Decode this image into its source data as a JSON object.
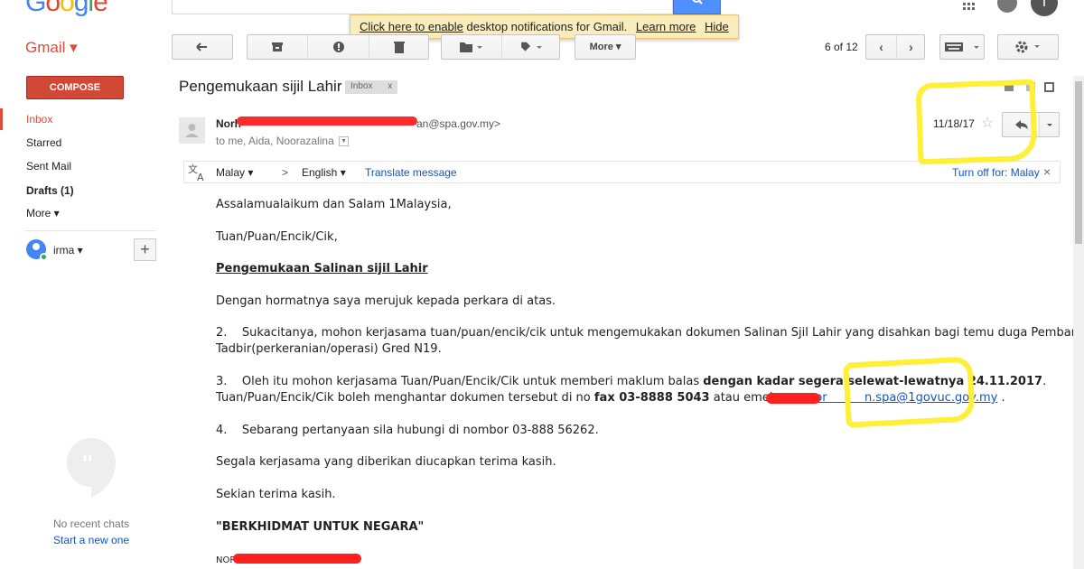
{
  "header": {
    "logo": [
      "G",
      "o",
      "o",
      "g",
      "l",
      "e"
    ],
    "notification": {
      "link1": "Click here to enable",
      "text": "desktop notifications for Gmail.",
      "learn_more": "Learn more",
      "hide": "Hide"
    },
    "avatar_letter": "I"
  },
  "sidebar": {
    "app_label": "Gmail ▾",
    "compose": "COMPOSE",
    "items": [
      {
        "label": "Inbox"
      },
      {
        "label": "Starred"
      },
      {
        "label": "Sent Mail"
      },
      {
        "label": "Drafts (1)"
      },
      {
        "label": "More ▾"
      }
    ],
    "user": "irma ▾",
    "no_chats": "No recent chats",
    "start_new": "Start a new one"
  },
  "toolbar": {
    "more": "More ▾",
    "pagination": "6 of 12"
  },
  "message": {
    "subject": "Pengemukaan sijil Lahir",
    "tag": "Inbox",
    "tag_close": "x",
    "sender_prefix": "Norh",
    "sender_suffix": "an@spa.gov.my>",
    "recipients": "to me, Aida, Noorazalina",
    "date": "11/18/17"
  },
  "translate": {
    "from": "Malay ▾",
    "arrow": ">",
    "to": "English ▾",
    "action": "Translate message",
    "turn_off": "Turn off for: Malay",
    "close": "×"
  },
  "body": {
    "greeting": "Assalamualaikum dan Salam 1Malaysia,",
    "salutation": "Tuan/Puan/Encik/Cik,",
    "heading": "Pengemukaan Salinan sijil Lahir",
    "p1": "Dengan hormatnya saya merujuk kepada perkara di atas.",
    "p2a": "2.    Sukacitanya, mohon kerjasama tuan/puan/encik/cik untuk mengemukakan dokumen Salinan Sjil Lahir yang disahkan bagi temu duga Pembantu",
    "p2b": "Tadbir(perkeranian/operasi) Gred N19.",
    "p3a": "3.    Oleh itu mohon kerjasama Tuan/Puan/Encik/Cik untuk memberi maklum balas ",
    "p3a_bold": "dengan kadar segera selewat-lewatnya 24.11.2017",
    "p3a_end": ".",
    "p3b": "Tuan/Puan/Encik/Cik boleh menghantar dokumen tersebut di no ",
    "p3b_bold": "fax 03-8888 5043",
    "p3b_mid": " atau emel saya ",
    "p3b_link": "nor          n.spa@1govuc.gov.my",
    "p3b_end": " .",
    "p4": "4.    Sebarang pertanyaan sila hubungi di nombor 03-888 56262.",
    "p5": "Segala kerjasama yang diberikan diucapkan terima kasih.",
    "p6": "Sekian terima kasih.",
    "motto": "\"BERKHIDMAT UNTUK NEGARA\"",
    "signature": "NOR"
  },
  "colors": {
    "accent": "#dd4b39",
    "link": "#1155cc",
    "highlight": "#ffef35"
  }
}
